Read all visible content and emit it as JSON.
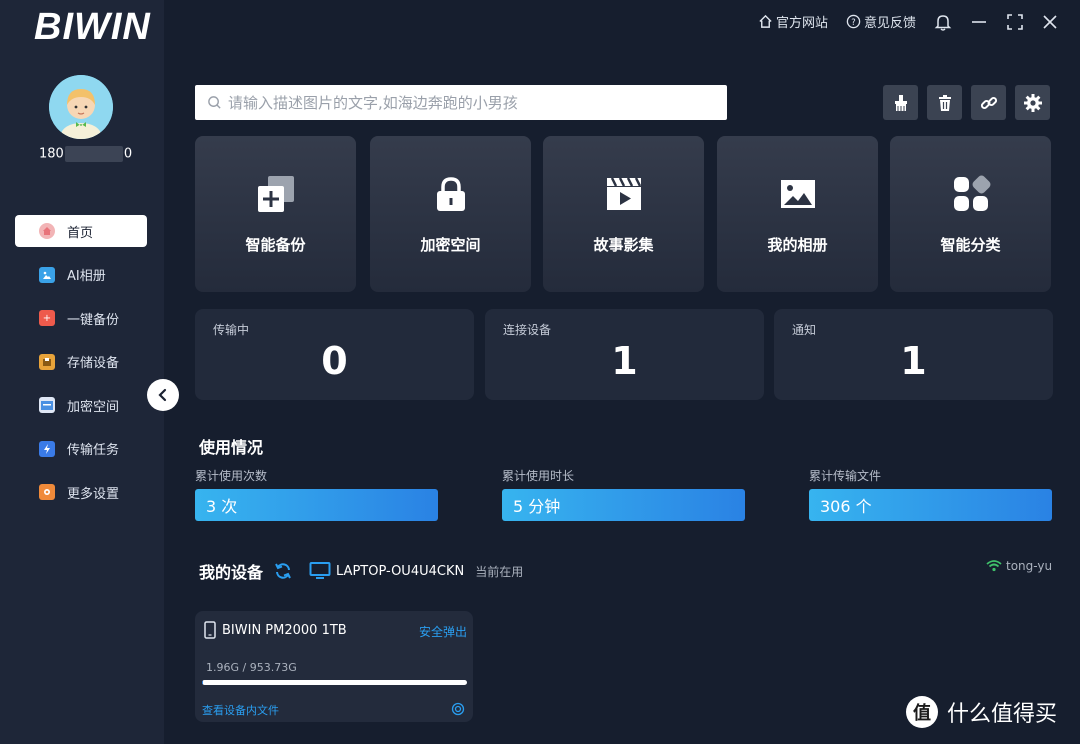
{
  "app": {
    "logo": "BIWIN"
  },
  "user": {
    "id_prefix": "180",
    "id_suffix": "0"
  },
  "topbar": {
    "official_site": "官方网站",
    "feedback": "意见反馈"
  },
  "sidebar": {
    "items": [
      {
        "label": "首页",
        "color": "#e8737a"
      },
      {
        "label": "AI相册",
        "color": "#3aa2e8"
      },
      {
        "label": "一键备份",
        "color": "#ee5a4c"
      },
      {
        "label": "存储设备",
        "color": "#e8a33a"
      },
      {
        "label": "加密空间",
        "color": "#4a90e2"
      },
      {
        "label": "传输任务",
        "color": "#3a7be8"
      },
      {
        "label": "更多设置",
        "color": "#f08a3a"
      }
    ]
  },
  "search": {
    "placeholder": "请输入描述图片的文字,如海边奔跑的小男孩"
  },
  "features": [
    {
      "label": "智能备份",
      "icon": "backup-plus-icon"
    },
    {
      "label": "加密空间",
      "icon": "lock-icon"
    },
    {
      "label": "故事影集",
      "icon": "clapperboard-icon"
    },
    {
      "label": "我的相册",
      "icon": "picture-icon"
    },
    {
      "label": "智能分类",
      "icon": "category-grid-icon"
    }
  ],
  "stats": [
    {
      "title": "传输中",
      "value": "0"
    },
    {
      "title": "连接设备",
      "value": "1"
    },
    {
      "title": "通知",
      "value": "1"
    }
  ],
  "usage": {
    "title": "使用情况",
    "items": [
      {
        "label": "累计使用次数",
        "value": "3 次"
      },
      {
        "label": "累计使用时长",
        "value": "5 分钟"
      },
      {
        "label": "累计传输文件",
        "value": "306 个"
      }
    ]
  },
  "devices": {
    "title": "我的设备",
    "computer_name": "LAPTOP-OU4U4CKN",
    "computer_status": "当前在用",
    "wifi_name": "tong-yu",
    "device": {
      "name": "BIWIN PM2000 1TB",
      "eject": "安全弹出",
      "usage_text": "1.96G / 953.73G",
      "used_fraction": 0.002,
      "browse_link": "查看设备内文件"
    }
  },
  "watermark": {
    "text": "什么值得买"
  },
  "colors": {
    "accent": "#2a82e4",
    "bg": "#161e2e",
    "sidebar": "#1e2638"
  }
}
